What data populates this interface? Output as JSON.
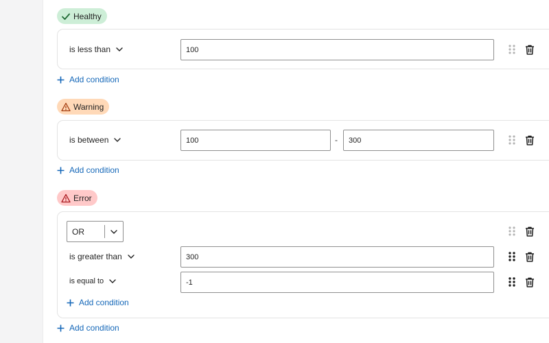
{
  "groups": [
    {
      "label": "Healthy",
      "icon": "checkmark-icon",
      "color": "#cdeed7",
      "conditions": [
        {
          "operator": "is less than",
          "value": "100"
        }
      ],
      "add_condition": "Add condition"
    },
    {
      "label": "Warning",
      "icon": "warning-icon",
      "color": "#ffd9b8",
      "conditions": [
        {
          "operator": "is between",
          "value_from": "100",
          "separator": "-",
          "value_to": "300"
        }
      ],
      "add_condition": "Add condition"
    },
    {
      "label": "Error",
      "icon": "warning-icon",
      "color": "#ffc9c9",
      "logic": "OR",
      "conditions": [
        {
          "operator": "is greater than",
          "value": "300"
        },
        {
          "operator": "is equal to",
          "value": "-1"
        }
      ],
      "inner_add_condition": "Add condition",
      "add_condition": "Add condition"
    }
  ]
}
